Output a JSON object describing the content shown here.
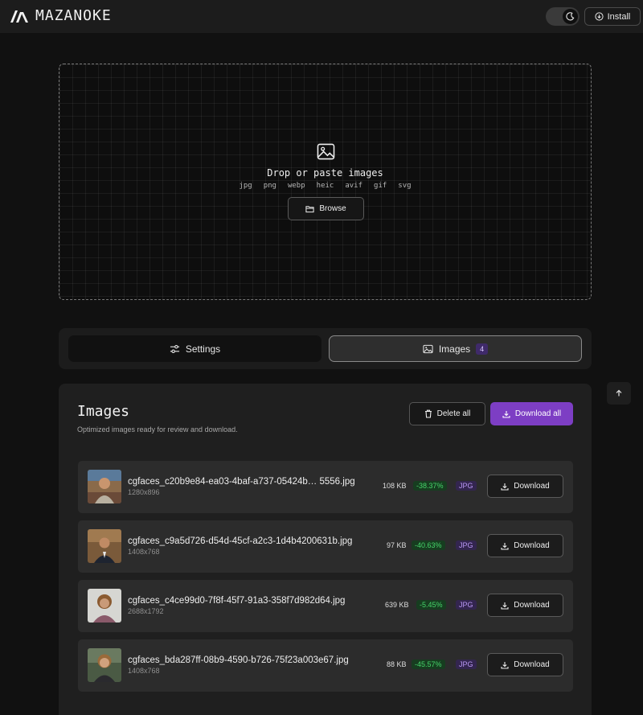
{
  "header": {
    "brand": "MAZANOKE",
    "install_label": "Install"
  },
  "dropzone": {
    "title": "Drop or paste images",
    "formats": [
      "jpg",
      "png",
      "webp",
      "heic",
      "avif",
      "gif",
      "svg"
    ],
    "browse_label": "Browse"
  },
  "tabs": {
    "settings_label": "Settings",
    "images_label": "Images",
    "images_count": "4"
  },
  "images_panel": {
    "title": "Images",
    "subtitle": "Optimized images ready for review and download.",
    "delete_all_label": "Delete all",
    "download_all_label": "Download all",
    "download_label": "Download",
    "items": [
      {
        "filename": "cgfaces_c20b9e84-ea03-4baf-a737-05424b… 5556.jpg",
        "dimensions": "1280x896",
        "size": "108 KB",
        "change": "-38.37%",
        "format": "JPG"
      },
      {
        "filename": "cgfaces_c9a5d726-d54d-45cf-a2c3-1d4b4200631b.jpg",
        "dimensions": "1408x768",
        "size": "97 KB",
        "change": "-40.63%",
        "format": "JPG"
      },
      {
        "filename": "cgfaces_c4ce99d0-7f8f-45f7-91a3-358f7d982d64.jpg",
        "dimensions": "2688x1792",
        "size": "639 KB",
        "change": "-5.45%",
        "format": "JPG"
      },
      {
        "filename": "cgfaces_bda287ff-08b9-4590-b726-75f23a003e67.jpg",
        "dimensions": "1408x768",
        "size": "88 KB",
        "change": "-45.57%",
        "format": "JPG"
      }
    ]
  },
  "colors": {
    "accent": "#7d3ec4",
    "positive": "#46d46a",
    "format_badge": "#b796f2"
  },
  "icons": [
    "logo-icon",
    "moon-icon",
    "download-circle-icon",
    "image-icon",
    "folder-icon",
    "sliders-icon",
    "arrow-up-icon",
    "trash-icon",
    "download-icon"
  ]
}
